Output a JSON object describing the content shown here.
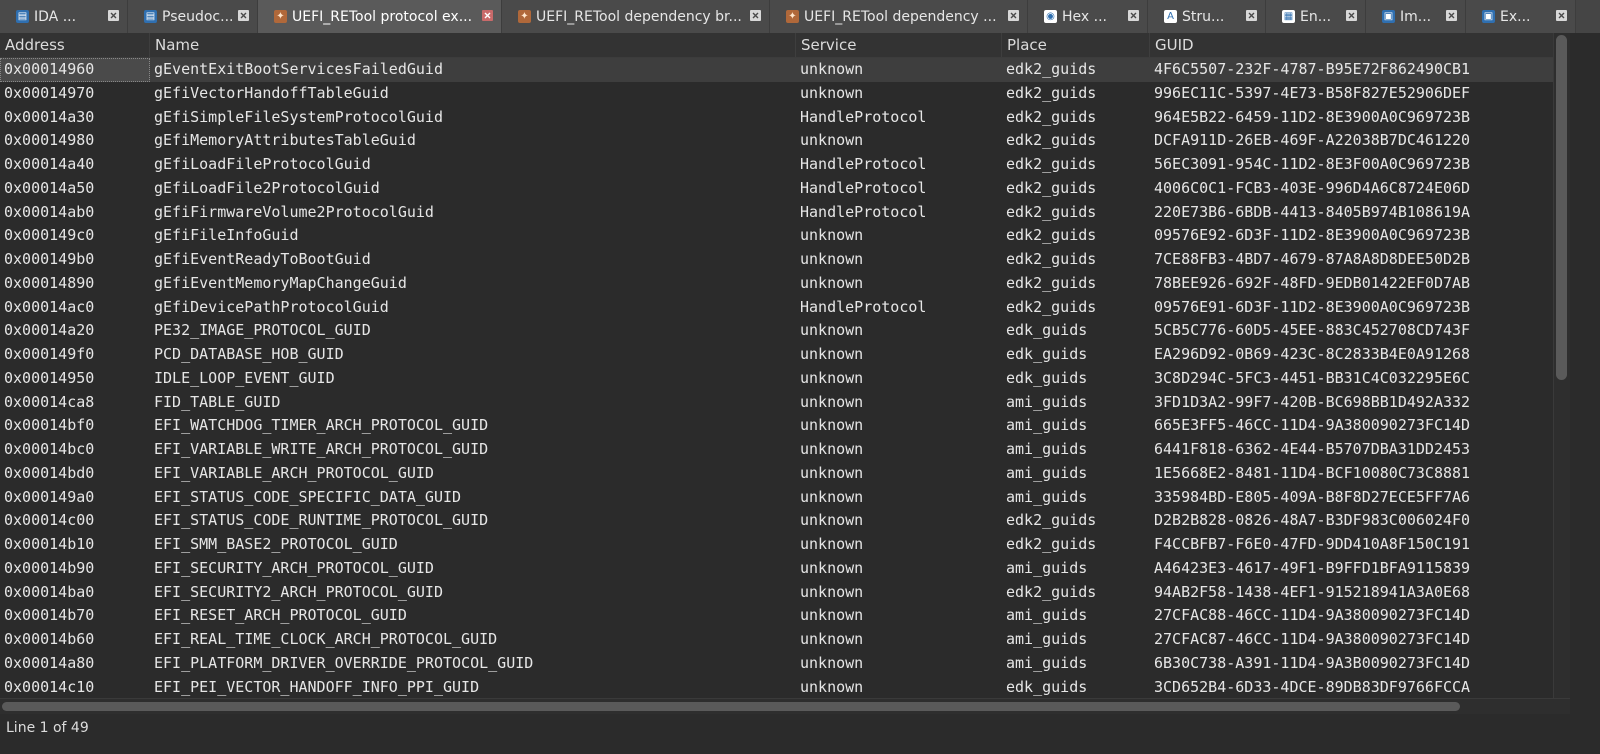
{
  "tabs": [
    {
      "label": "IDA ...",
      "icon": "ida-view-icon",
      "active": false
    },
    {
      "label": "Pseudoc...",
      "icon": "pseudocode-icon",
      "active": false
    },
    {
      "label": "UEFI_RETool protocol ex...",
      "icon": "retool-icon",
      "active": true
    },
    {
      "label": "UEFI_RETool dependency br...",
      "icon": "retool-icon",
      "active": false
    },
    {
      "label": "UEFI_RETool dependency ...",
      "icon": "retool-icon",
      "active": false
    },
    {
      "label": "Hex ...",
      "icon": "hex-view-icon",
      "active": false
    },
    {
      "label": "Stru...",
      "icon": "structures-icon",
      "active": false
    },
    {
      "label": "En...",
      "icon": "enums-icon",
      "active": false
    },
    {
      "label": "Im...",
      "icon": "imports-icon",
      "active": false
    },
    {
      "label": "Ex...",
      "icon": "exports-icon",
      "active": false
    }
  ],
  "columns": [
    "Address",
    "Name",
    "Service",
    "Place",
    "GUID"
  ],
  "rows": [
    [
      "0x00014960",
      "gEventExitBootServicesFailedGuid",
      "unknown",
      "edk2_guids",
      "4F6C5507-232F-4787-B95E72F862490CB1"
    ],
    [
      "0x00014970",
      "gEfiVectorHandoffTableGuid",
      "unknown",
      "edk2_guids",
      "996EC11C-5397-4E73-B58F827E52906DEF"
    ],
    [
      "0x00014a30",
      "gEfiSimpleFileSystemProtocolGuid",
      "HandleProtocol",
      "edk2_guids",
      "964E5B22-6459-11D2-8E3900A0C969723B"
    ],
    [
      "0x00014980",
      "gEfiMemoryAttributesTableGuid",
      "unknown",
      "edk2_guids",
      "DCFA911D-26EB-469F-A22038B7DC461220"
    ],
    [
      "0x00014a40",
      "gEfiLoadFileProtocolGuid",
      "HandleProtocol",
      "edk2_guids",
      "56EC3091-954C-11D2-8E3F00A0C969723B"
    ],
    [
      "0x00014a50",
      "gEfiLoadFile2ProtocolGuid",
      "HandleProtocol",
      "edk2_guids",
      "4006C0C1-FCB3-403E-996D4A6C8724E06D"
    ],
    [
      "0x00014ab0",
      "gEfiFirmwareVolume2ProtocolGuid",
      "HandleProtocol",
      "edk2_guids",
      "220E73B6-6BDB-4413-8405B974B108619A"
    ],
    [
      "0x000149c0",
      "gEfiFileInfoGuid",
      "unknown",
      "edk2_guids",
      "09576E92-6D3F-11D2-8E3900A0C969723B"
    ],
    [
      "0x000149b0",
      "gEfiEventReadyToBootGuid",
      "unknown",
      "edk2_guids",
      "7CE88FB3-4BD7-4679-87A8A8D8DEE50D2B"
    ],
    [
      "0x00014890",
      "gEfiEventMemoryMapChangeGuid",
      "unknown",
      "edk2_guids",
      "78BEE926-692F-48FD-9EDB01422EF0D7AB"
    ],
    [
      "0x00014ac0",
      "gEfiDevicePathProtocolGuid",
      "HandleProtocol",
      "edk2_guids",
      "09576E91-6D3F-11D2-8E3900A0C969723B"
    ],
    [
      "0x00014a20",
      "PE32_IMAGE_PROTOCOL_GUID",
      "unknown",
      "edk_guids",
      "5CB5C776-60D5-45EE-883C452708CD743F"
    ],
    [
      "0x000149f0",
      "PCD_DATABASE_HOB_GUID",
      "unknown",
      "edk_guids",
      "EA296D92-0B69-423C-8C2833B4E0A91268"
    ],
    [
      "0x00014950",
      "IDLE_LOOP_EVENT_GUID",
      "unknown",
      "edk_guids",
      "3C8D294C-5FC3-4451-BB31C4C032295E6C"
    ],
    [
      "0x00014ca8",
      "FID_TABLE_GUID",
      "unknown",
      "ami_guids",
      "3FD1D3A2-99F7-420B-BC698BB1D492A332"
    ],
    [
      "0x00014bf0",
      "EFI_WATCHDOG_TIMER_ARCH_PROTOCOL_GUID",
      "unknown",
      "ami_guids",
      "665E3FF5-46CC-11D4-9A380090273FC14D"
    ],
    [
      "0x00014bc0",
      "EFI_VARIABLE_WRITE_ARCH_PROTOCOL_GUID",
      "unknown",
      "ami_guids",
      "6441F818-6362-4E44-B5707DBA31DD2453"
    ],
    [
      "0x00014bd0",
      "EFI_VARIABLE_ARCH_PROTOCOL_GUID",
      "unknown",
      "ami_guids",
      "1E5668E2-8481-11D4-BCF10080C73C8881"
    ],
    [
      "0x000149a0",
      "EFI_STATUS_CODE_SPECIFIC_DATA_GUID",
      "unknown",
      "ami_guids",
      "335984BD-E805-409A-B8F8D27ECE5FF7A6"
    ],
    [
      "0x00014c00",
      "EFI_STATUS_CODE_RUNTIME_PROTOCOL_GUID",
      "unknown",
      "edk2_guids",
      "D2B2B828-0826-48A7-B3DF983C006024F0"
    ],
    [
      "0x00014b10",
      "EFI_SMM_BASE2_PROTOCOL_GUID",
      "unknown",
      "edk2_guids",
      "F4CCBFB7-F6E0-47FD-9DD410A8F150C191"
    ],
    [
      "0x00014b90",
      "EFI_SECURITY_ARCH_PROTOCOL_GUID",
      "unknown",
      "ami_guids",
      "A46423E3-4617-49F1-B9FFD1BFA9115839"
    ],
    [
      "0x00014ba0",
      "EFI_SECURITY2_ARCH_PROTOCOL_GUID",
      "unknown",
      "edk2_guids",
      "94AB2F58-1438-4EF1-915218941A3A0E68"
    ],
    [
      "0x00014b70",
      "EFI_RESET_ARCH_PROTOCOL_GUID",
      "unknown",
      "ami_guids",
      "27CFAC88-46CC-11D4-9A380090273FC14D"
    ],
    [
      "0x00014b60",
      "EFI_REAL_TIME_CLOCK_ARCH_PROTOCOL_GUID",
      "unknown",
      "ami_guids",
      "27CFAC87-46CC-11D4-9A380090273FC14D"
    ],
    [
      "0x00014a80",
      "EFI_PLATFORM_DRIVER_OVERRIDE_PROTOCOL_GUID",
      "unknown",
      "ami_guids",
      "6B30C738-A391-11D4-9A3B0090273FC14D"
    ],
    [
      "0x00014c10",
      "EFI_PEI_VECTOR_HANDOFF_INFO_PPI_GUID",
      "unknown",
      "edk_guids",
      "3CD652B4-6D33-4DCE-89DB83DF9766FCCA"
    ]
  ],
  "selected_row": 0,
  "status": {
    "text": "Line 1 of 49"
  },
  "colors": {
    "background": "#2b2b2b",
    "tabbar": "#454545",
    "active_tab": "#5a5a5a",
    "text": "#e6e6e6",
    "close_active": "#c96a6a"
  }
}
